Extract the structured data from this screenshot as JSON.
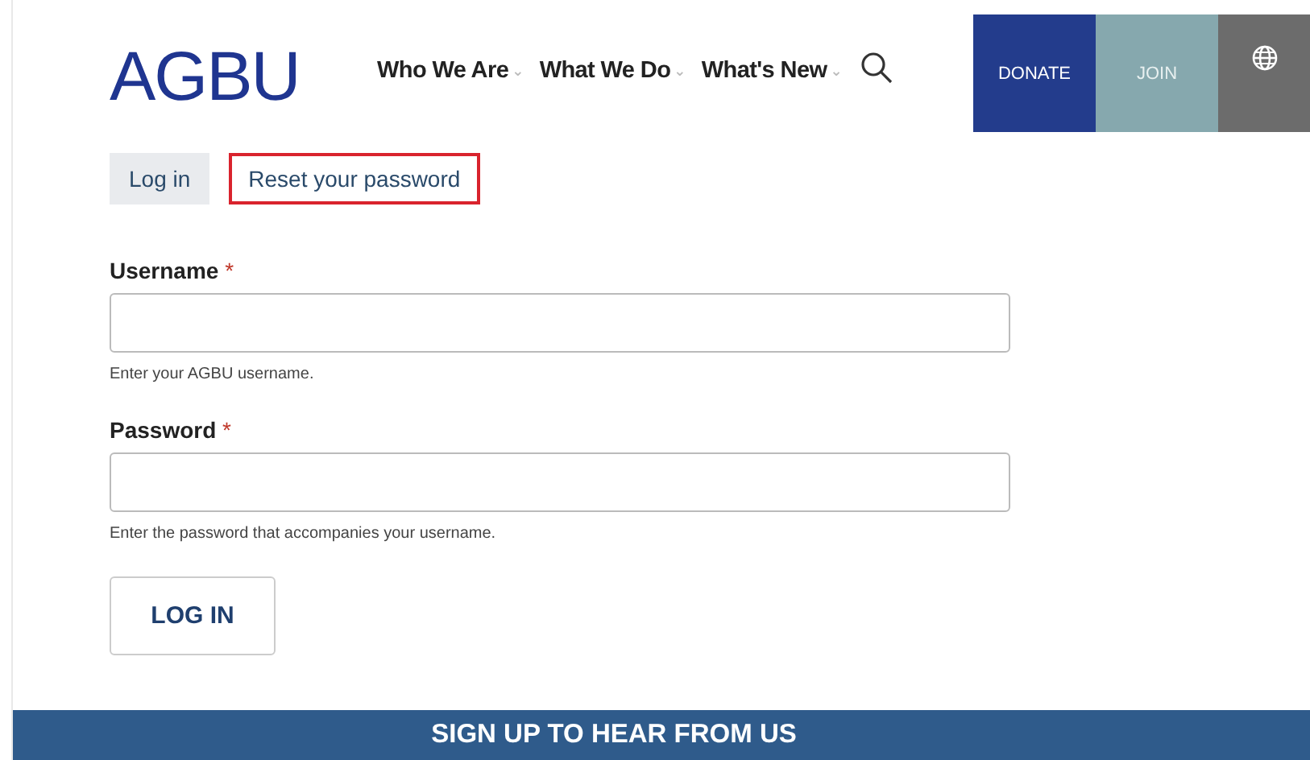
{
  "header": {
    "logo": "AGBU",
    "nav": [
      {
        "label": "Who We Are",
        "caret": "⌄"
      },
      {
        "label": "What We Do",
        "caret": "⌄"
      },
      {
        "label": "What's New",
        "caret": "⌄"
      }
    ],
    "actions": [
      {
        "label": "DONATE",
        "kind": "donate"
      },
      {
        "label": "JOIN",
        "kind": "join"
      },
      {
        "kind": "language"
      }
    ]
  },
  "tabs": [
    {
      "label": "Log in",
      "selected": true,
      "highlighted": false
    },
    {
      "label": "Reset your password",
      "selected": false,
      "highlighted": true
    }
  ],
  "form": {
    "fields": [
      {
        "label": "Username",
        "required_mark": "*",
        "help": "Enter your AGBU username."
      },
      {
        "label": "Password",
        "required_mark": "*",
        "help": "Enter the password that accompanies your username."
      }
    ],
    "submit": "LOG IN"
  },
  "footer_banner": "SIGN UP TO HEAR FROM US"
}
